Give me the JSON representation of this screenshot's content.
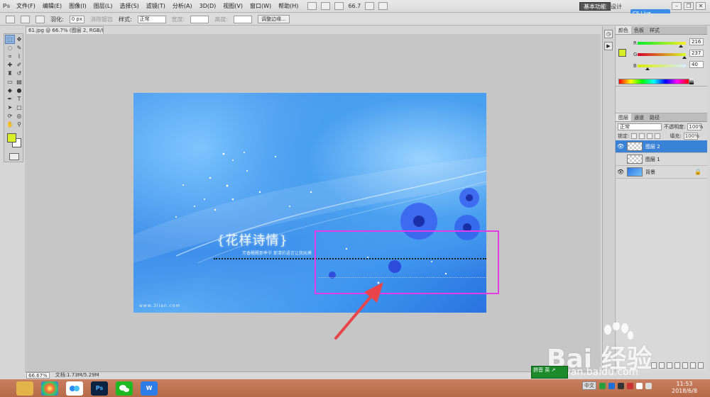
{
  "menubar": {
    "app_icon": "Ps",
    "items": [
      "文件(F)",
      "编辑(E)",
      "图像(I)",
      "图层(L)",
      "选择(S)",
      "滤镜(T)",
      "分析(A)",
      "3D(D)",
      "视图(V)",
      "窗口(W)",
      "帮助(H)"
    ],
    "zoom": "66.7",
    "workspace": "基本功能",
    "design": "设计",
    "cs_live": "CS Live"
  },
  "options": {
    "feather_label": "羽化:",
    "feather_value": "0 px",
    "antialias": "消除锯齿",
    "style_label": "样式:",
    "style_value": "正常",
    "width_label": "宽度:",
    "height_label": "高度:",
    "refine": "调整边缘..."
  },
  "document": {
    "tab": "61.jpg @ 66.7% (图层 2, RGB/8#) *",
    "zoom": "66.67%",
    "file_info": "文档:1.73M/5.29M"
  },
  "image": {
    "title": "{花样诗情}",
    "subtitle": "芳香醒醒那季节  那清的语言让我抚摸",
    "url": "www.3lian.com"
  },
  "color_panel": {
    "tabs": [
      "颜色",
      "色板",
      "样式"
    ],
    "r_label": "R",
    "g_label": "G",
    "b_label": "B",
    "r": "216",
    "g": "237",
    "b": "40",
    "fg_color": "#d8ef28",
    "r_level": 0.85,
    "g_level": 0.93,
    "b_level": 0.16
  },
  "layers_panel": {
    "tabs": [
      "图层",
      "通道",
      "路径"
    ],
    "blend_mode": "正常",
    "opacity_label": "不透明度:",
    "opacity": "100%",
    "lock_label": "锁定:",
    "fill_label": "填充:",
    "fill": "100%",
    "layers": [
      {
        "name": "图层 2",
        "selected": true,
        "visible": true
      },
      {
        "name": "图层 1",
        "selected": false,
        "visible": false
      },
      {
        "name": "背景",
        "selected": false,
        "visible": true
      }
    ]
  },
  "watermark": {
    "logo": "Bai 经验",
    "url": "jingyan.baidu.com"
  },
  "ime_badge": "拼音 英 ↗",
  "taskbar": {
    "apps": [
      "explorer-icon",
      "browser-icon",
      "baidu-netdisk-icon",
      "photoshop-icon",
      "wechat-icon",
      "wps-icon"
    ],
    "ps_label": "Ps",
    "wps_label": "W",
    "tray_lang": "中文",
    "time": "11:53",
    "date": "2018/6/8"
  },
  "colors": {
    "accent_highlight": "#e33be6",
    "arrow": "#e8454a",
    "selection_blue": "#3a82d6"
  }
}
